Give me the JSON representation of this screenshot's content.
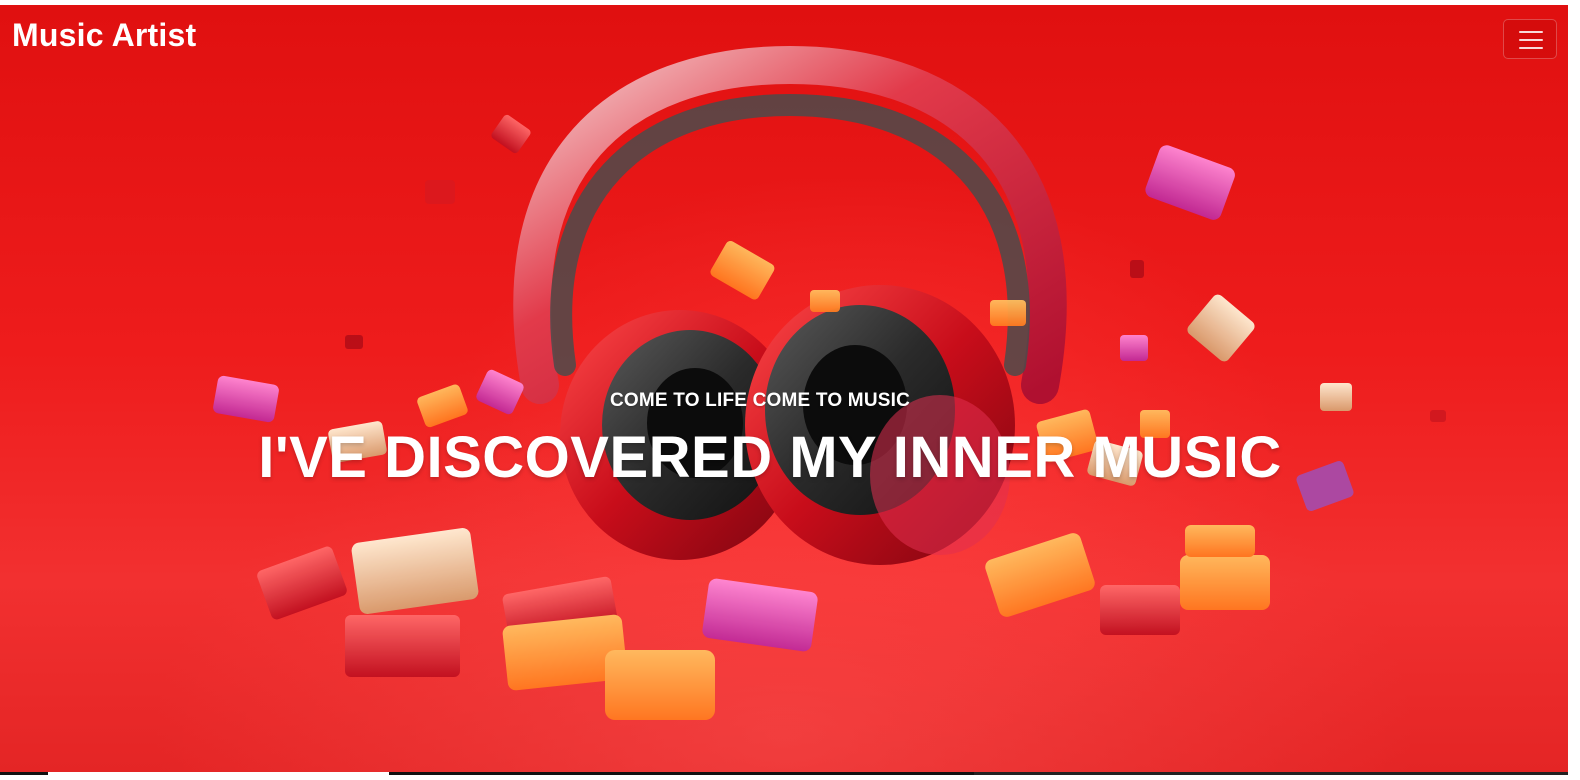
{
  "navbar": {
    "brand": "Music Artist",
    "menu_icon": "hamburger-menu-icon"
  },
  "hero": {
    "subtitle": "COME TO LIFE COME TO MUSIC",
    "headline": "I'VE DISCOVERED MY INNER MUSIC",
    "image_icon": "headphones-image"
  },
  "carousel": {
    "indicators": [
      {
        "active": false
      },
      {
        "active": true
      },
      {
        "active": false
      },
      {
        "active": false
      }
    ]
  },
  "colors": {
    "hero_background": "#e01010",
    "text": "#ffffff",
    "indicator_active": "#ffffff",
    "indicator_inactive": "#000000"
  }
}
